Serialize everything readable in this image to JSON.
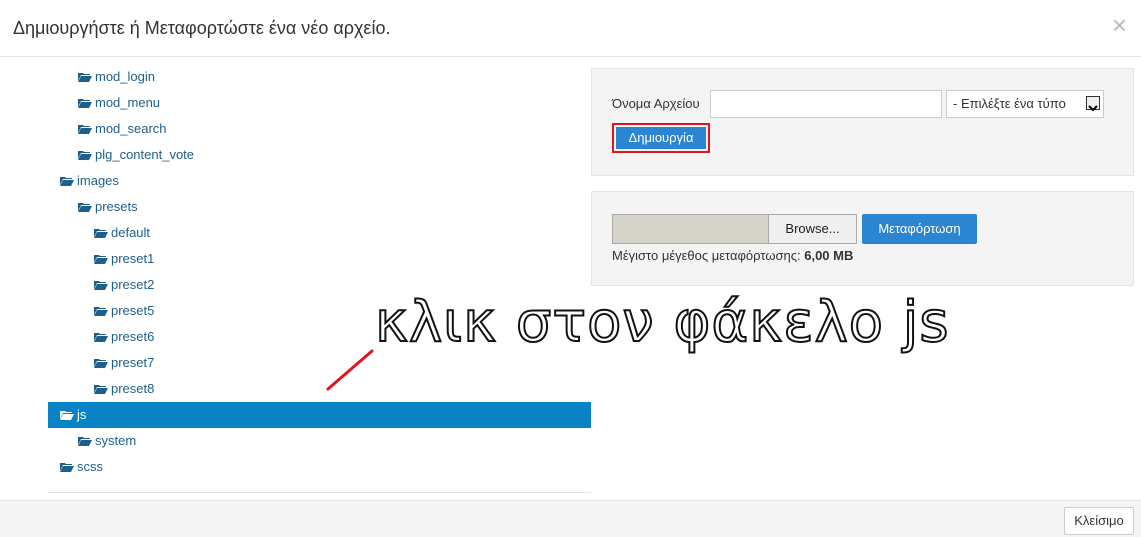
{
  "dialog": {
    "title": "Δημιουργήστε ή Μεταφορτώστε ένα νέο αρχείο.",
    "close_glyph": "×"
  },
  "tree": [
    {
      "label": "mod_login",
      "level": 2,
      "selected": false
    },
    {
      "label": "mod_menu",
      "level": 2,
      "selected": false
    },
    {
      "label": "mod_search",
      "level": 2,
      "selected": false
    },
    {
      "label": "plg_content_vote",
      "level": 2,
      "selected": false
    },
    {
      "label": "images",
      "level": 1,
      "selected": false
    },
    {
      "label": "presets",
      "level": 2,
      "selected": false
    },
    {
      "label": "default",
      "level": 3,
      "selected": false
    },
    {
      "label": "preset1",
      "level": 3,
      "selected": false
    },
    {
      "label": "preset2",
      "level": 3,
      "selected": false
    },
    {
      "label": "preset5",
      "level": 3,
      "selected": false
    },
    {
      "label": "preset6",
      "level": 3,
      "selected": false
    },
    {
      "label": "preset7",
      "level": 3,
      "selected": false
    },
    {
      "label": "preset8",
      "level": 3,
      "selected": false
    },
    {
      "label": "js",
      "level": 1,
      "selected": true
    },
    {
      "label": "system",
      "level": 2,
      "selected": false
    },
    {
      "label": "scss",
      "level": 1,
      "selected": false
    }
  ],
  "create_panel": {
    "filename_label": "Όνομα Αρχείου",
    "filename_value": "",
    "type_select": "- Επιλέξτε ένα τύπο",
    "create_button": "Δημιουργία"
  },
  "upload_panel": {
    "browse_button": "Browse...",
    "upload_button": "Μεταφόρτωση",
    "max_size_label": "Μέγιστο μέγεθος μεταφόρτωσης:",
    "max_size_value": "6,00 MB"
  },
  "footer": {
    "close_button": "Κλείσιμο"
  },
  "annotation": {
    "text": "κλικ στον φάκελο js",
    "color_fill": "#ffffff",
    "color_stroke": "#111111",
    "highlight_color": "#e0141e"
  },
  "colors": {
    "selection": "#0a83c6",
    "primary_button": "#2c85d1",
    "link": "#1f5f8b"
  }
}
